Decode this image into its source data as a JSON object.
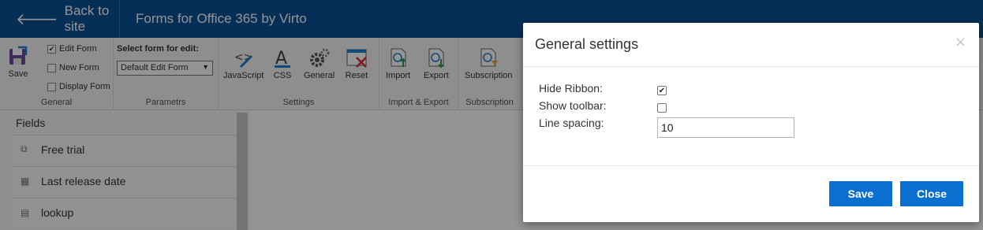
{
  "topbar": {
    "back_label": "Back to site",
    "app_title": "Forms for Office 365 by Virto"
  },
  "ribbon": {
    "general": {
      "label": "General",
      "save_label": "Save",
      "checkboxes": [
        {
          "label": "Edit Form",
          "checked": true
        },
        {
          "label": "New Form",
          "checked": false
        },
        {
          "label": "Display Form",
          "checked": false
        }
      ]
    },
    "parametrs": {
      "label": "Parametrs",
      "select_label": "Select form for edit:",
      "select_value": "Default Edit Form"
    },
    "settings": {
      "label": "Settings",
      "buttons": [
        "JavaScript",
        "CSS",
        "General",
        "Reset"
      ]
    },
    "import_export": {
      "label": "Import & Export",
      "buttons": [
        "Import",
        "Export"
      ]
    },
    "subscription": {
      "label": "Subscription",
      "button": "Subscription"
    }
  },
  "fields": {
    "title": "Fields",
    "items": [
      {
        "label": "Free trial",
        "icon": "textbox-icon"
      },
      {
        "label": "Last release date",
        "icon": "calendar-icon"
      },
      {
        "label": "lookup",
        "icon": "lookup-icon"
      }
    ]
  },
  "modal": {
    "title": "General settings",
    "close_glyph": "×",
    "hide_ribbon_label": "Hide Ribbon:",
    "hide_ribbon_checked": true,
    "show_toolbar_label": "Show toolbar:",
    "show_toolbar_checked": false,
    "line_spacing_label": "Line spacing:",
    "line_spacing_value": "10",
    "save_label": "Save",
    "close_label": "Close"
  },
  "colors": {
    "topbar": "#0b5196",
    "primary_button": "#0a6fcf"
  }
}
